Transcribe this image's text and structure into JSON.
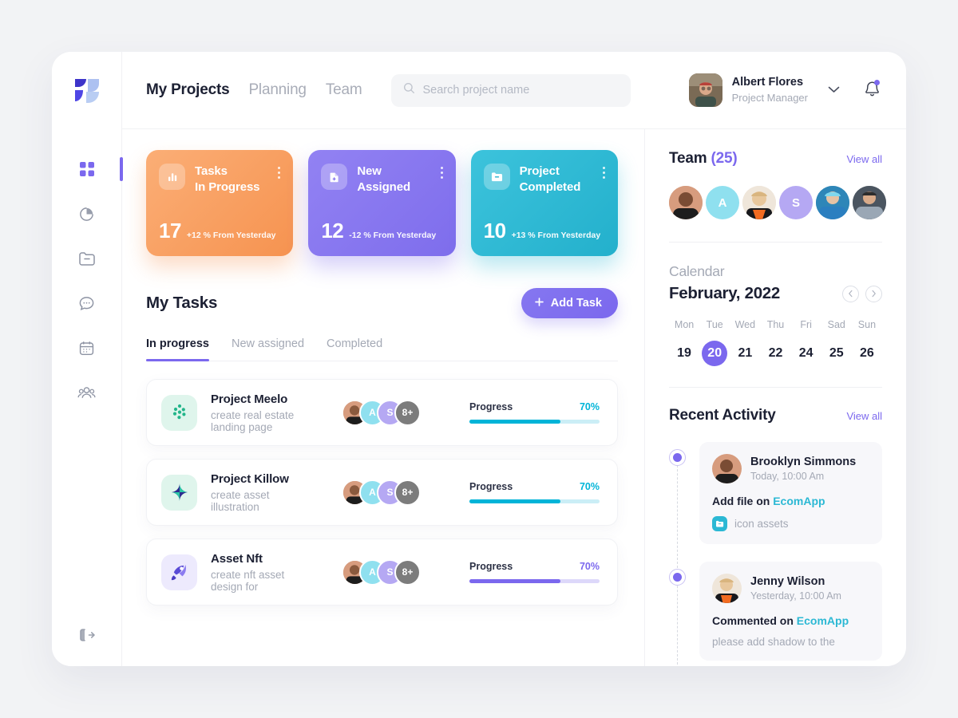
{
  "brand": {
    "logo_icon": "app-logo"
  },
  "sidebar": {
    "items": [
      {
        "name": "dashboard",
        "icon": "grid-icon",
        "active": true
      },
      {
        "name": "analytics",
        "icon": "pie-chart-icon",
        "active": false
      },
      {
        "name": "projects",
        "icon": "folder-minus-icon",
        "active": false
      },
      {
        "name": "messages",
        "icon": "chat-bubble-icon",
        "active": false
      },
      {
        "name": "calendar",
        "icon": "calendar-icon",
        "active": false
      },
      {
        "name": "team",
        "icon": "users-icon",
        "active": false
      }
    ],
    "logout_icon": "logout-icon"
  },
  "topbar": {
    "nav": [
      {
        "label": "My Projects",
        "active": true
      },
      {
        "label": "Planning",
        "active": false
      },
      {
        "label": "Team",
        "active": false
      }
    ],
    "search": {
      "placeholder": "Search project name",
      "value": "",
      "icon": "search-icon"
    },
    "profile": {
      "name": "Albert Flores",
      "role": "Project Manager",
      "chevron": "chevron-down-icon"
    },
    "bell_icon": "notification-bell-icon"
  },
  "stats": [
    {
      "title_line1": "Tasks",
      "title_line2": "In Progress",
      "value": "17",
      "delta": "+12 % From Yesterday",
      "color": "#F9A263",
      "color2": "#F6954F",
      "icon": "bar-chart-icon"
    },
    {
      "title_line1": "New",
      "title_line2": "Assigned",
      "value": "12",
      "delta": "-12 % From Yesterday",
      "color": "#8B7CF0",
      "color2": "#7E6DEC",
      "icon": "file-plus-icon"
    },
    {
      "title_line1": "Project",
      "title_line2": "Completed",
      "value": "10",
      "delta": "+13 % From Yesterday",
      "color": "#2FBBD6",
      "color2": "#23B2CE",
      "icon": "folder-minus-icon"
    }
  ],
  "tasks_section": {
    "title": "My Tasks",
    "add_button": "Add Task",
    "tabs": [
      {
        "label": "In progress",
        "active": true
      },
      {
        "label": "New assigned",
        "active": false
      },
      {
        "label": "Completed",
        "active": false
      }
    ],
    "progress_label": "Progress",
    "overflow_badge": "8+",
    "rows": [
      {
        "name": "Project Meelo",
        "subtitle": "create real estate landing page",
        "icon": "dots-cluster-icon",
        "icon_bg": "#DFF5EC",
        "icon_color": "#22B58A",
        "progress": "70%",
        "progress_value": 70,
        "bar_color": "#00B4D8",
        "bar_track": "#CBEEF6",
        "pct_color": "#00B4D8"
      },
      {
        "name": "Project Killow",
        "subtitle": "create asset illustration",
        "icon": "diamond-icon",
        "icon_bg": "#DFF5EC",
        "icon_color": "#2D2B8F",
        "progress": "70%",
        "progress_value": 70,
        "bar_color": "#00B4D8",
        "bar_track": "#CBEEF6",
        "pct_color": "#00B4D8"
      },
      {
        "name": "Asset Nft",
        "subtitle": "create nft asset design for",
        "icon": "rocket-icon",
        "icon_bg": "#EDEAFD",
        "icon_color": "#5A4BD6",
        "progress": "70%",
        "progress_value": 70,
        "bar_color": "#7B68EE",
        "bar_track": "#DDD8FA",
        "pct_color": "#7B68EE"
      }
    ]
  },
  "team": {
    "title": "Team",
    "count": "(25)",
    "view_all": "View all",
    "members": [
      {
        "type": "photo",
        "color": "#C98E72"
      },
      {
        "type": "initial",
        "initial": "A",
        "color": "#8FE0EF"
      },
      {
        "type": "photo",
        "color": "#E8DCCF"
      },
      {
        "type": "initial",
        "initial": "S",
        "color": "#B5A8F3"
      },
      {
        "type": "photo",
        "color": "#2D7FAE"
      },
      {
        "type": "photo",
        "color": "#56636E"
      }
    ]
  },
  "calendar": {
    "label": "Calendar",
    "month": "February, 2022",
    "prev_icon": "chevron-left-icon",
    "next_icon": "chevron-right-icon",
    "dow": [
      "Mon",
      "Tue",
      "Wed",
      "Thu",
      "Fri",
      "Sad",
      "Sun"
    ],
    "days": [
      {
        "n": "19",
        "selected": false
      },
      {
        "n": "20",
        "selected": true
      },
      {
        "n": "21",
        "selected": false
      },
      {
        "n": "22",
        "selected": false
      },
      {
        "n": "24",
        "selected": false
      },
      {
        "n": "25",
        "selected": false
      },
      {
        "n": "26",
        "selected": false
      }
    ]
  },
  "activity": {
    "title": "Recent Activity",
    "view_all": "View all",
    "items": [
      {
        "name": "Brooklyn Simmons",
        "time": "Today, 10:00 Am",
        "action_prefix": "Add file on ",
        "action_link": "EcomApp",
        "file_name": "icon assets",
        "file_icon": "folder-minus-icon",
        "avatar_color": "#C98E72",
        "text": ""
      },
      {
        "name": "Jenny Wilson",
        "time": "Yesterday, 10:00 Am",
        "action_prefix": "Commented on ",
        "action_link": "EcomApp",
        "file_name": "",
        "file_icon": "",
        "avatar_color": "#E8DCCF",
        "text": "please add shadow to the"
      }
    ]
  }
}
